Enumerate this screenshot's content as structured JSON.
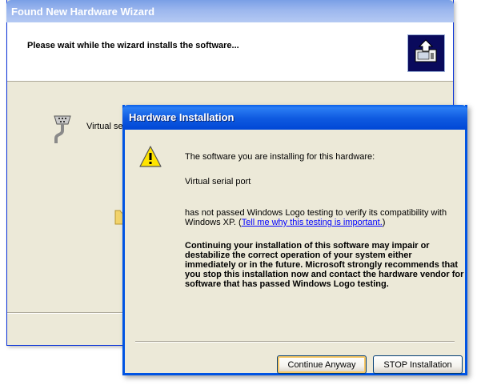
{
  "wizard": {
    "title": "Found New Hardware Wizard",
    "heading": "Please wait while the wizard installs the software...",
    "device_label": "Virtual se"
  },
  "dialog": {
    "title": "Hardware Installation",
    "line1": "The software you are installing for this hardware:",
    "device_name": "Virtual serial port",
    "logo_text_before": "has not passed Windows Logo testing to verify its compatibility with Windows XP. (",
    "logo_link": "Tell me why this testing is important.",
    "logo_text_after": ")",
    "warning": "Continuing your installation of this software may impair or destabilize the correct operation of your system either immediately or in the future. Microsoft strongly recommends that you stop this installation now and contact the hardware vendor for software that has passed Windows Logo testing.",
    "continue_button": "Continue Anyway",
    "stop_button": "STOP Installation"
  },
  "icons": {
    "wizard_logo": "hardware-wizard-icon",
    "device": "serial-port-icon",
    "folder": "folder-icon",
    "warning": "warning-icon"
  }
}
